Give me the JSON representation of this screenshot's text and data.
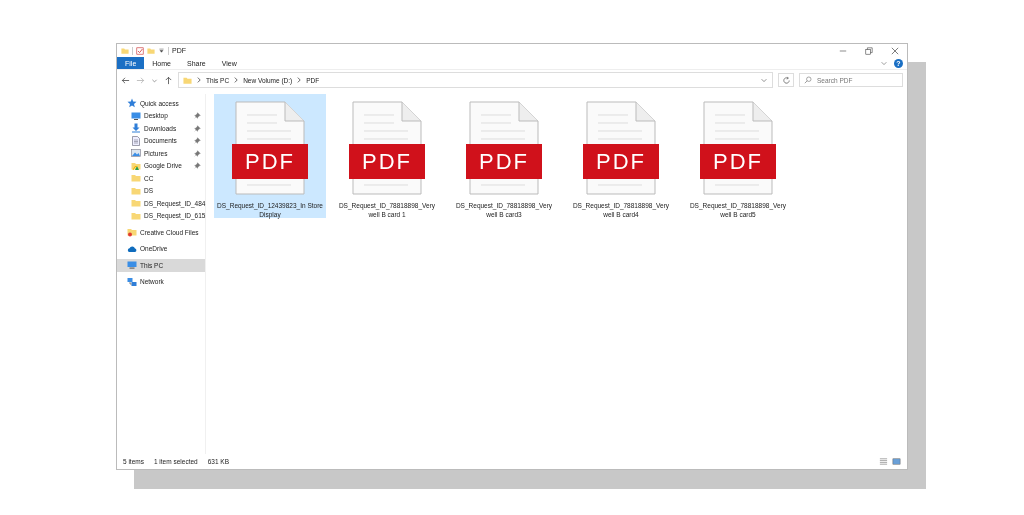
{
  "window": {
    "title": "PDF"
  },
  "ribbon": {
    "tabs": [
      {
        "label": "File",
        "selected": true
      },
      {
        "label": "Home",
        "selected": false
      },
      {
        "label": "Share",
        "selected": false
      },
      {
        "label": "View",
        "selected": false
      }
    ],
    "help": "?"
  },
  "address": {
    "path": [
      "This PC",
      "New Volume (D:)",
      "PDF"
    ]
  },
  "search": {
    "placeholder": "Search PDF"
  },
  "sidebar": {
    "items": [
      {
        "label": "Quick access",
        "kind": "star",
        "selected": false,
        "children": [
          {
            "label": "Desktop",
            "kind": "desktop",
            "pinned": true,
            "selected": false
          },
          {
            "label": "Downloads",
            "kind": "download",
            "pinned": true,
            "selected": false
          },
          {
            "label": "Documents",
            "kind": "document",
            "pinned": true,
            "selected": false
          },
          {
            "label": "Pictures",
            "kind": "pictures",
            "pinned": true,
            "selected": false
          },
          {
            "label": "Google Drive",
            "kind": "drive",
            "pinned": true,
            "selected": false
          },
          {
            "label": "CC",
            "kind": "folder",
            "pinned": false,
            "selected": false
          },
          {
            "label": "DS",
            "kind": "folder",
            "pinned": false,
            "selected": false
          },
          {
            "label": "DS_Request_ID_484",
            "kind": "folder",
            "pinned": false,
            "selected": false
          },
          {
            "label": "DS_Request_ID_615",
            "kind": "folder",
            "pinned": false,
            "selected": false
          }
        ]
      },
      {
        "label": "Creative Cloud Files",
        "kind": "ccfiles",
        "selected": false
      },
      {
        "label": "OneDrive",
        "kind": "cloud",
        "selected": false
      },
      {
        "label": "This PC",
        "kind": "pc",
        "selected": true
      },
      {
        "label": "Network",
        "kind": "network",
        "selected": false
      }
    ]
  },
  "files": [
    {
      "name": "DS_Request_ID_12439823_In Store Display",
      "badge": "PDF",
      "selected": true
    },
    {
      "name": "DS_Request_ID_78818898_Very well B card 1",
      "badge": "PDF",
      "selected": false
    },
    {
      "name": "DS_Request_ID_78818898_Very well B card3",
      "badge": "PDF",
      "selected": false
    },
    {
      "name": "DS_Request_ID_78818898_Very well B card4",
      "badge": "PDF",
      "selected": false
    },
    {
      "name": "DS_Request_ID_78818898_Very well B card5",
      "badge": "PDF",
      "selected": false
    }
  ],
  "status_bar": {
    "item_count": "5 items",
    "selection": "1 item selected",
    "size": "631 KB"
  }
}
